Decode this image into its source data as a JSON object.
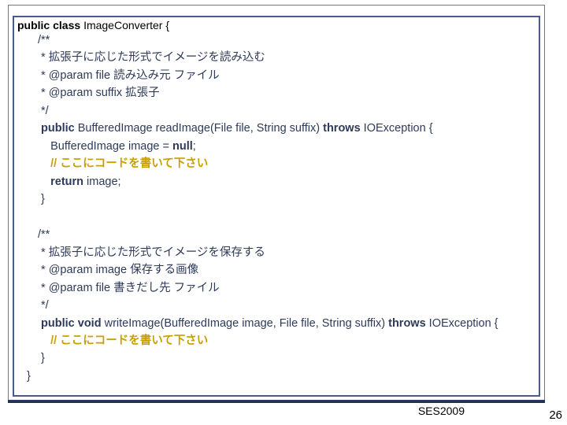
{
  "slide": {
    "class_declaration": {
      "prefix_kw1": "public",
      "prefix_kw2": "class",
      "name": "ImageConverter",
      "brace": "{"
    },
    "block1": {
      "l0": "/**",
      "l1": " * 拡張子に応じた形式でイメージを読み込む",
      "l2": " * @param file 読み込み元 ファイル",
      "l3": " * @param suffix 拡張子",
      "l4": " */",
      "sig_pre": " public",
      "sig_mid": " BufferedImage readImage(File file, String suffix) ",
      "sig_throws": "throws",
      "sig_post": " IOException {",
      "b1": "    BufferedImage image = ",
      "b1_kw": "null",
      "b1_end": ";",
      "b2": "    // ここにコードを書いて下さい",
      "b3_pre": "    ",
      "b3_kw": "return",
      "b3_post": " image;",
      "b4": " }"
    },
    "block2": {
      "l0": "/**",
      "l1": " * 拡張子に応じた形式でイメージを保存する",
      "l2": " * @param image 保存する画像",
      "l3": " * @param file 書きだし先 ファイル",
      "l4": " */",
      "sig_pre": " public void",
      "sig_mid": " writeImage(BufferedImage image, File file, String suffix) ",
      "sig_throws": "throws",
      "sig_post": " IOException {",
      "b1": "    // ここにコードを書いて下さい",
      "b2": " }"
    },
    "class_end": "}",
    "footer": "SES2009",
    "page": "26"
  }
}
